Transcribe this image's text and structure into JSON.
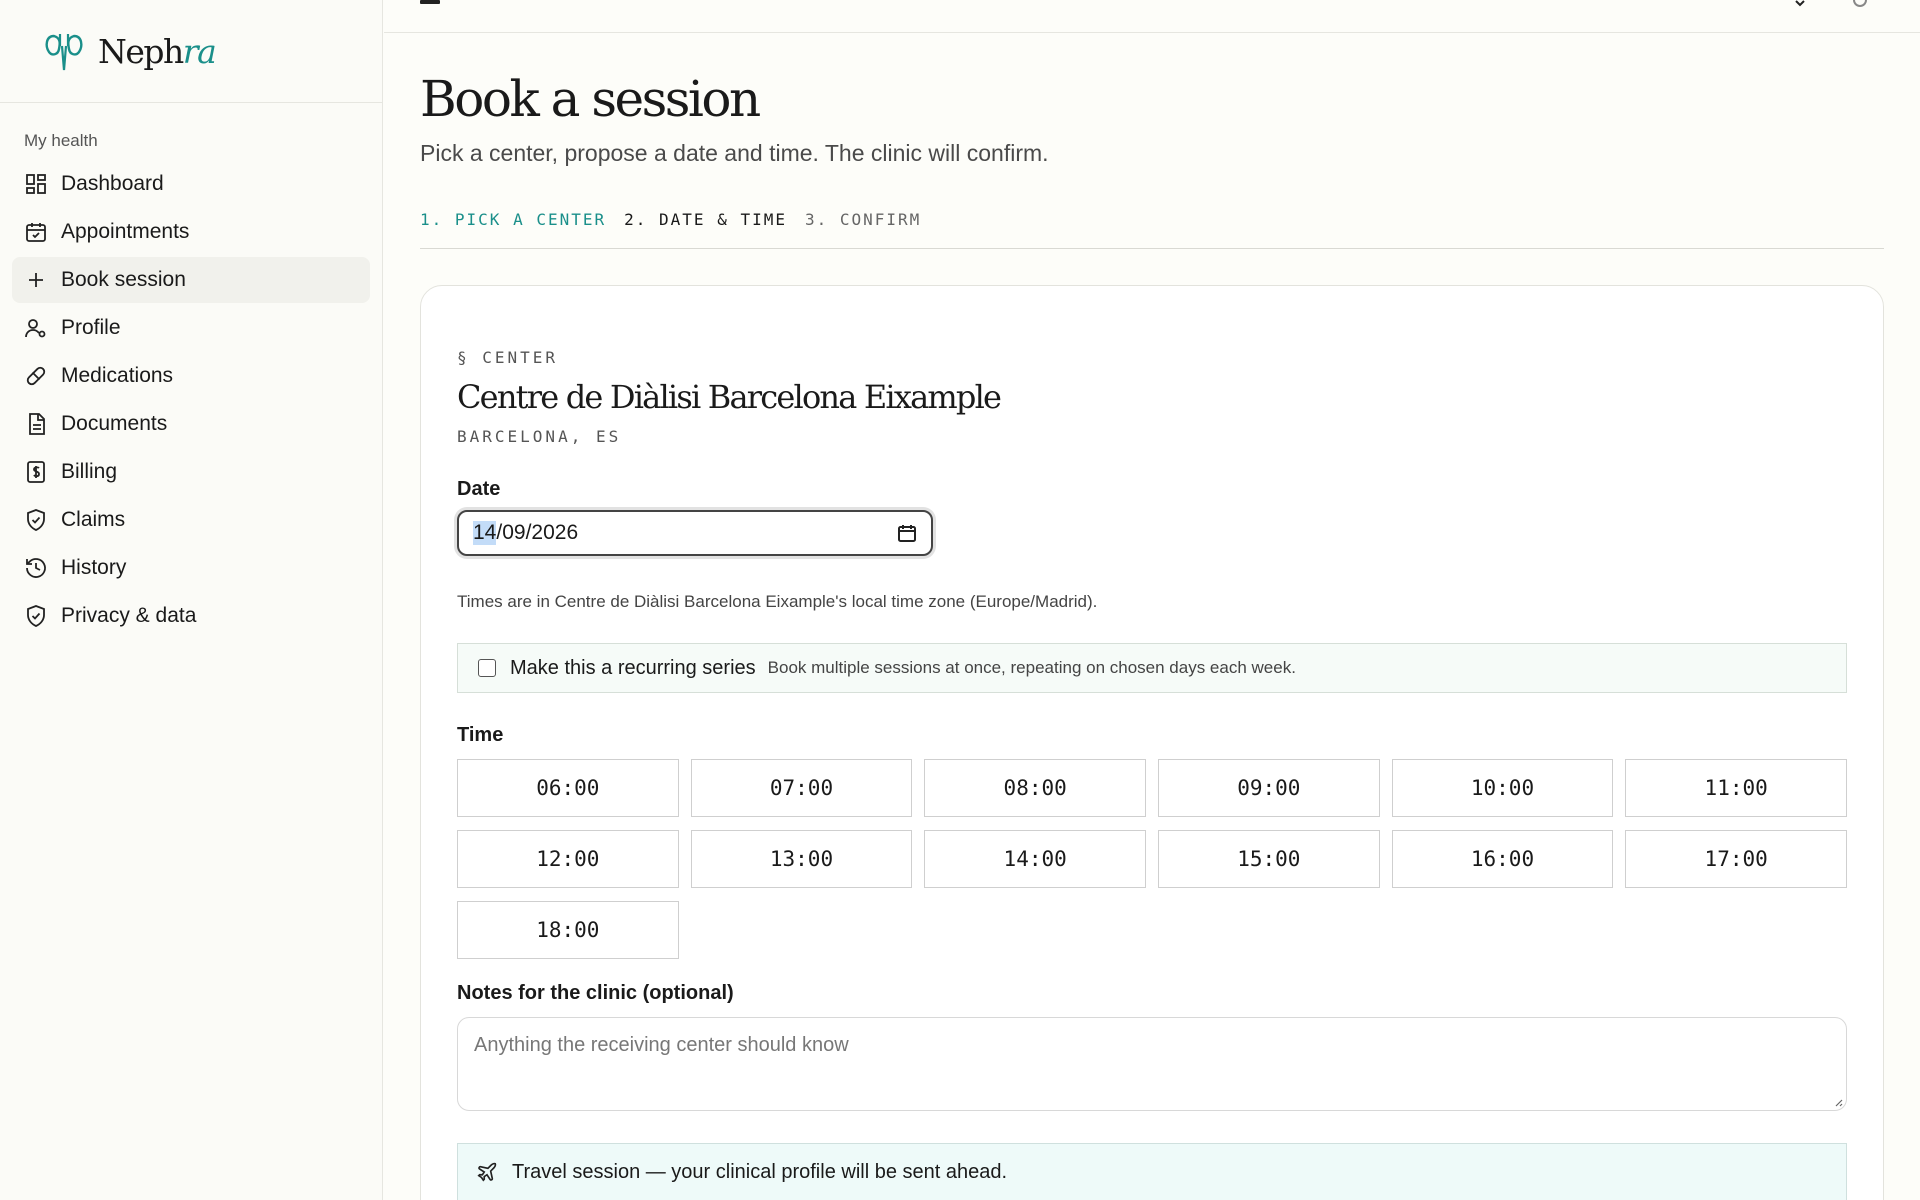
{
  "app": {
    "brand_main": "Neph",
    "brand_accent": "ra"
  },
  "sidebar": {
    "section_label": "My health",
    "items": [
      {
        "label": "Dashboard",
        "icon": "dashboard-icon"
      },
      {
        "label": "Appointments",
        "icon": "calendar-icon"
      },
      {
        "label": "Book session",
        "icon": "plus-icon"
      },
      {
        "label": "Profile",
        "icon": "user-gear-icon"
      },
      {
        "label": "Medications",
        "icon": "pill-icon"
      },
      {
        "label": "Documents",
        "icon": "document-icon"
      },
      {
        "label": "Billing",
        "icon": "dollar-receipt-icon"
      },
      {
        "label": "Claims",
        "icon": "shield-check-icon"
      },
      {
        "label": "History",
        "icon": "history-icon"
      },
      {
        "label": "Privacy & data",
        "icon": "shield-check-icon"
      }
    ],
    "active_item": "Book session"
  },
  "page": {
    "title": "Book a session",
    "subtitle": "Pick a center, propose a date and time. The clinic will confirm."
  },
  "steps": [
    {
      "label": "1. PICK A CENTER",
      "state": "done"
    },
    {
      "label": "2. DATE & TIME",
      "state": "current"
    },
    {
      "label": "3. CONFIRM",
      "state": "pending"
    }
  ],
  "center": {
    "section_label": "§ CENTER",
    "name": "Centre de Diàlisi Barcelona Eixample",
    "location": "BARCELONA, ES"
  },
  "date": {
    "label": "Date",
    "day": "14",
    "month": "09",
    "year": "2026",
    "timezone_note": "Times are in Centre de Diàlisi Barcelona Eixample's local time zone (Europe/Madrid)."
  },
  "recurring": {
    "title": "Make this a recurring series",
    "description": "Book multiple sessions at once, repeating on chosen days each week.",
    "checked": false
  },
  "time": {
    "label": "Time",
    "slots": [
      "06:00",
      "07:00",
      "08:00",
      "09:00",
      "10:00",
      "11:00",
      "12:00",
      "13:00",
      "14:00",
      "15:00",
      "16:00",
      "17:00",
      "18:00"
    ]
  },
  "notes": {
    "label": "Notes for the clinic (optional)",
    "placeholder": "Anything the receiving center should know"
  },
  "travel": {
    "text": "Travel session — your clinical profile will be sent ahead."
  },
  "colors": {
    "accent": "#1a8f8a",
    "highlight": "#c3dcf8"
  }
}
